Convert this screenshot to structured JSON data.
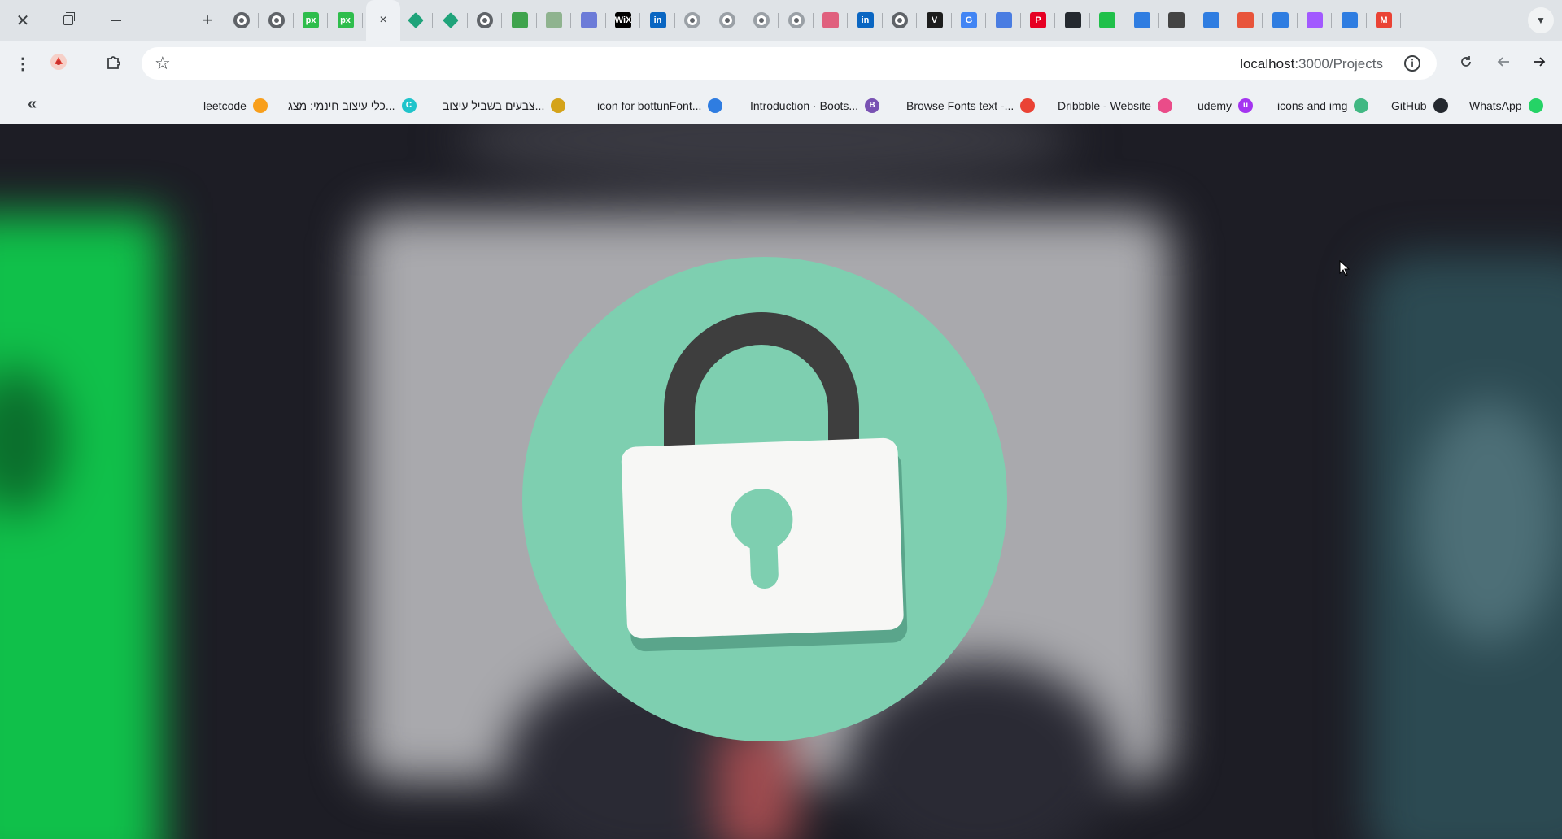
{
  "window": {
    "close_icon": "close-icon",
    "restore_icon": "restore-icon",
    "minimize_icon": "minimize-icon"
  },
  "tabs": {
    "new_tab_label": "+",
    "active_close_label": "×",
    "dropdown_label": "⌄",
    "favicons": [
      {
        "icon": "chrome-icon",
        "color": "#5f6368"
      },
      {
        "icon": "chrome-icon",
        "color": "#5f6368"
      },
      {
        "icon": "px-icon",
        "color": "#2ebd4c",
        "text": "px"
      },
      {
        "icon": "px-icon",
        "color": "#2ebd4c",
        "text": "px"
      },
      {
        "icon": "diamond-icon",
        "color": "#1fa37a"
      },
      {
        "icon": "diamond-icon",
        "color": "#1fa37a"
      },
      {
        "icon": "chrome-icon",
        "color": "#5f6368"
      },
      {
        "icon": "infinity-icon",
        "color": "#3fa34d"
      },
      {
        "icon": "vue-icon",
        "color": "#8fb38f"
      },
      {
        "icon": "lines-icon",
        "color": "#6c7bd8"
      },
      {
        "icon": "wix-icon",
        "color": "#000000",
        "text": "WiX"
      },
      {
        "icon": "linkedin-icon",
        "color": "#0a66c2",
        "text": "in"
      },
      {
        "icon": "globe-icon",
        "color": "#80868b"
      },
      {
        "icon": "globe-icon",
        "color": "#80868b"
      },
      {
        "icon": "globe-icon",
        "color": "#80868b"
      },
      {
        "icon": "globe-icon",
        "color": "#80868b"
      },
      {
        "icon": "flower-icon",
        "color": "#e0607e"
      },
      {
        "icon": "linkedin-icon",
        "color": "#0a66c2",
        "text": "in"
      },
      {
        "icon": "chrome-icon",
        "color": "#5f6368"
      },
      {
        "icon": "vim-icon",
        "color": "#1d1d1d",
        "text": "V"
      },
      {
        "icon": "google-icon",
        "color": "#4285f4",
        "text": "G"
      },
      {
        "icon": "heart-icon",
        "color": "#4a7de2"
      },
      {
        "icon": "pinterest-icon",
        "color": "#e60023",
        "text": "P"
      },
      {
        "icon": "github-icon",
        "color": "#24292f"
      },
      {
        "icon": "green-square-icon",
        "color": "#20c04a"
      },
      {
        "icon": "bolt-icon",
        "color": "#2f7de1"
      },
      {
        "icon": "openai-icon",
        "color": "#444444"
      },
      {
        "icon": "bolt-icon",
        "color": "#2f7de1"
      },
      {
        "icon": "chart-icon",
        "color": "#e8543b"
      },
      {
        "icon": "bolt-icon",
        "color": "#2f7de1"
      },
      {
        "icon": "figma-icon",
        "color": "#a259ff"
      },
      {
        "icon": "bolt-icon",
        "color": "#2f7de1"
      },
      {
        "icon": "gmail-icon",
        "color": "#ea4335",
        "text": "M"
      }
    ]
  },
  "toolbar": {
    "menu_icon": "kebab-menu-icon",
    "profile_icon": "profile-icon",
    "extensions_icon": "extensions-icon",
    "bookmark_star_icon": "star-icon",
    "url_host": "localhost",
    "url_rest": ":3000/Projects",
    "site_info_label": "i",
    "reload_icon": "reload-icon",
    "back_icon": "back-arrow-icon",
    "forward_icon": "forward-arrow-icon"
  },
  "bookmarks": {
    "collapse_label": "«",
    "items": [
      {
        "label": "leetcode",
        "icon": "leetcode-icon",
        "color": "#f89f1b"
      },
      {
        "label": "כלי עיצוב חינמי: מצג...",
        "icon": "canva-icon",
        "color": "#20c4cb",
        "text": "C"
      },
      {
        "label": "צבעים בשביל עיצוב...",
        "icon": "paint-icon",
        "color": "#d4a31a"
      },
      {
        "label": "icon for bottunFont...",
        "icon": "flag-icon",
        "color": "#2f7de1"
      },
      {
        "label": "Introduction · Boots...",
        "icon": "bootstrap-icon",
        "color": "#7952b3",
        "text": "B"
      },
      {
        "label": "Browse Fonts text -...",
        "icon": "fonts-icon",
        "color": "#ea4335"
      },
      {
        "label": "Dribbble - Website",
        "icon": "dribbble-icon",
        "color": "#ea4c89"
      },
      {
        "label": "udemy",
        "icon": "udemy-icon",
        "color": "#a435f0",
        "text": "ū"
      },
      {
        "label": "icons and img",
        "icon": "vue-icon",
        "color": "#41b883"
      },
      {
        "label": "GitHub",
        "icon": "github-icon",
        "color": "#24292f"
      },
      {
        "label": "WhatsApp",
        "icon": "whatsapp-icon",
        "color": "#25d366"
      }
    ]
  },
  "page": {
    "lock_art_icon": "padlock-icon",
    "colors": {
      "circle": "#7ecfb0",
      "shackle": "#3e3e3e",
      "body": "#f7f7f5",
      "body_shadow": "#5aa58b",
      "keyhole": "#7ecfb0"
    }
  }
}
